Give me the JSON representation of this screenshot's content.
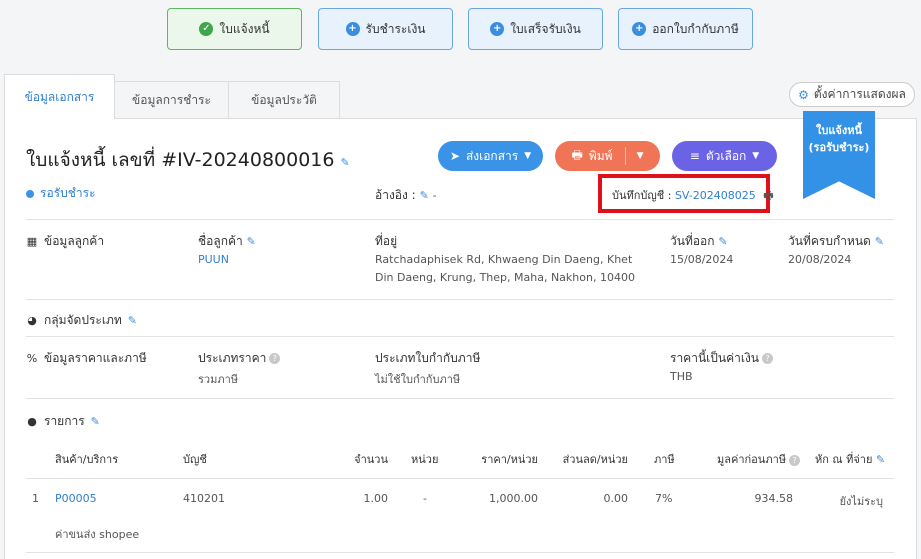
{
  "steps": [
    {
      "label": "ใบแจ้งหนี้",
      "icon": "check-icon",
      "state": "active"
    },
    {
      "label": "รับชำระเงิน",
      "icon": "plus-icon",
      "state": "inactive"
    },
    {
      "label": "ใบเสร็จรับเงิน",
      "icon": "plus-icon",
      "state": "inactive"
    },
    {
      "label": "ออกใบกำกับภาษี",
      "icon": "plus-icon",
      "state": "inactive"
    }
  ],
  "tabs": [
    "ข้อมูลเอกสาร",
    "ข้อมูลการชำระ",
    "ข้อมูลประวัติ"
  ],
  "display_settings": "ตั้งค่าการแสดงผล",
  "ribbon": {
    "line1": "ใบแจ้งหนี้",
    "line2": "(รอรับชำระ)"
  },
  "doc": {
    "title": "ใบแจ้งหนี้ เลขที่ #IV-20240800016",
    "status": "รอรับชำระ",
    "ref_label": "อ้างอิง :",
    "ref_value": "-",
    "ledger_label": "บันทึกบัญชี :",
    "ledger_value": "SV-202408025"
  },
  "actions": {
    "send": "ส่งเอกสาร",
    "print": "พิมพ์",
    "options": "ตัวเลือก"
  },
  "customer": {
    "section": "ข้อมูลลูกค้า",
    "name_label": "ชื่อลูกค้า",
    "name_value": "PUUN",
    "address_label": "ที่อยู่",
    "address_value": "Ratchadaphisek Rd, Khwaeng Din Daeng, Khet Din Daeng, Krung, Thep, Maha, Nakhon, 10400",
    "issue_label": "วันที่ออก",
    "issue_value": "15/08/2024",
    "due_label": "วันที่ครบกำหนด",
    "due_value": "20/08/2024"
  },
  "category": {
    "section": "กลุ่มจัดประเภท"
  },
  "pricing": {
    "section": "ข้อมูลราคาและภาษี",
    "price_type_label": "ประเภทราคา",
    "price_type_value": "รวมภาษี",
    "tax_invoice_label": "ประเภทใบกำกับภาษี",
    "tax_invoice_value": "ไม่ใช้ใบกำกับภาษี",
    "currency_label": "ราคานี้เป็นค่าเงิน",
    "currency_value": "THB"
  },
  "items": {
    "section": "รายการ",
    "headers": [
      "สินค้า/บริการ",
      "บัญชี",
      "จำนวน",
      "หน่วย",
      "ราคา/หน่วย",
      "ส่วนลด/หน่วย",
      "ภาษี",
      "มูลค่าก่อนภาษี",
      "หัก ณ ที่จ่าย"
    ],
    "rows": [
      {
        "no": "1",
        "product": "P00005",
        "account": "410201",
        "qty": "1.00",
        "unit": "-",
        "price": "1,000.00",
        "discount": "0.00",
        "tax": "7%",
        "pretax": "934.58",
        "wht": "ยังไม่ระบุ",
        "desc": "ค่าขนส่ง shopee"
      }
    ]
  },
  "colors": {
    "primary": "#3b93e8",
    "print": "#f07456",
    "options": "#6b63e6",
    "highlight": "#e0101a",
    "success": "#3fa64c"
  }
}
